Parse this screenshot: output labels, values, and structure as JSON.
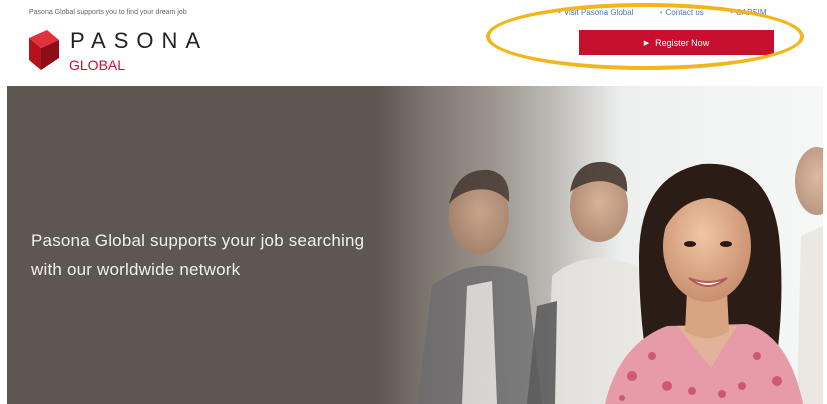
{
  "header": {
    "tagline": "Pasona Global supports you to find your dream job",
    "logo_word": "PASONA",
    "logo_sub": "GLOBAL",
    "links": [
      "Visit Pasona Global",
      "Contact us",
      "CAPSIM"
    ],
    "register_label": "Register Now"
  },
  "hero": {
    "line1": "Pasona Global supports your job searching",
    "line2": "with our worldwide network"
  },
  "colors": {
    "brand_red": "#c8102e",
    "hero_bg": "#5e5650",
    "highlight": "#f4b51c",
    "link_blue": "#4a78b8"
  }
}
